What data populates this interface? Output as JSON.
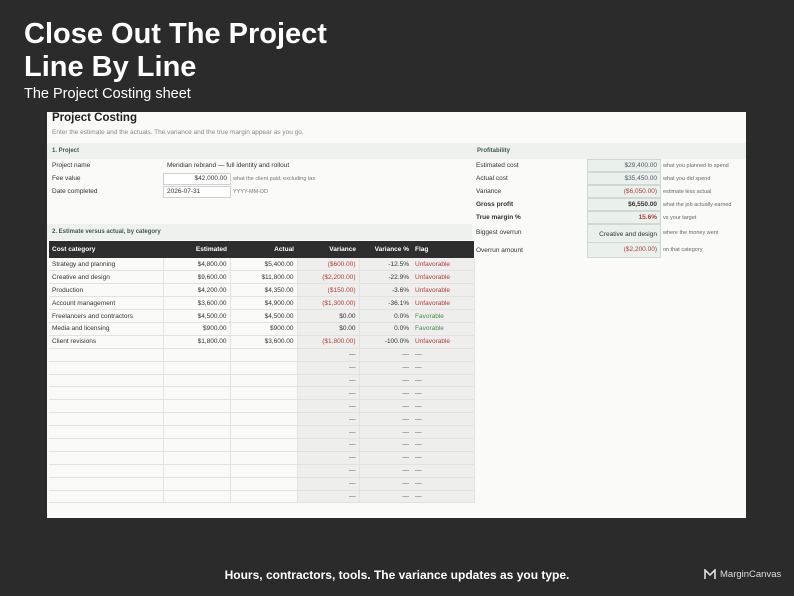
{
  "hero": {
    "title_line1": "Close Out The Project",
    "title_line2": "Line By Line",
    "subtitle": "The Project Costing sheet"
  },
  "sheet": {
    "title": "Project Costing",
    "description": "Enter the estimate and the actuals. The variance and the true margin appear as you go.",
    "project_section": "1. Project",
    "fields": {
      "project_name_label": "Project name",
      "project_name_value": "Meridian rebrand — full identity and rollout",
      "fee_value_label": "Fee value",
      "fee_value_value": "$42,000.00",
      "fee_value_note": "what the client paid, excluding tax",
      "date_completed_label": "Date completed",
      "date_completed_value": "2026-07-31",
      "date_completed_note": "YYYY-MM-DD"
    },
    "estimate_section": "2. Estimate versus actual, by category",
    "table": {
      "headers": [
        "Cost category",
        "Estimated",
        "Actual",
        "Variance",
        "Variance %",
        "Flag"
      ],
      "rows": [
        {
          "category": "Strategy and planning",
          "estimated": "$4,800.00",
          "actual": "$5,400.00",
          "variance": "($600.00)",
          "variance_pct": "-12.5%",
          "flag": "Unfavorable"
        },
        {
          "category": "Creative and design",
          "estimated": "$9,600.00",
          "actual": "$11,800.00",
          "variance": "($2,200.00)",
          "variance_pct": "-22.9%",
          "flag": "Unfavorable"
        },
        {
          "category": "Production",
          "estimated": "$4,200.00",
          "actual": "$4,350.00",
          "variance": "($150.00)",
          "variance_pct": "-3.6%",
          "flag": "Unfavorable"
        },
        {
          "category": "Account management",
          "estimated": "$3,600.00",
          "actual": "$4,900.00",
          "variance": "($1,300.00)",
          "variance_pct": "-36.1%",
          "flag": "Unfavorable"
        },
        {
          "category": "Freelancers and contractors",
          "estimated": "$4,500.00",
          "actual": "$4,500.00",
          "variance": "$0.00",
          "variance_pct": "0.0%",
          "flag": "Favorable"
        },
        {
          "category": "Media and licensing",
          "estimated": "$900.00",
          "actual": "$900.00",
          "variance": "$0.00",
          "variance_pct": "0.0%",
          "flag": "Favorable"
        },
        {
          "category": "Client revisions",
          "estimated": "$1,800.00",
          "actual": "$3,600.00",
          "variance": "($1,800.00)",
          "variance_pct": "-100.0%",
          "flag": "Unfavorable"
        }
      ],
      "empty_dash": "—"
    },
    "profitability": {
      "heading": "Profitability",
      "estimated_cost_label": "Estimated cost",
      "estimated_cost_value": "$29,400.00",
      "estimated_cost_note": "what you planned to spend",
      "actual_cost_label": "Actual cost",
      "actual_cost_value": "$35,450.00",
      "actual_cost_note": "what you did spend",
      "variance_label": "Variance",
      "variance_value": "($6,050.00)",
      "variance_note": "estimate less actual",
      "gross_profit_label": "Gross profit",
      "gross_profit_value": "$6,550.00",
      "gross_profit_note": "what the job actually earned",
      "true_margin_label": "True margin %",
      "true_margin_value": "15.6%",
      "true_margin_note": "vs your target",
      "biggest_overrun_label": "Biggest overrun",
      "biggest_overrun_value": "Creative and design",
      "biggest_overrun_note": "where the money went",
      "overrun_amount_label": "Overrun amount",
      "overrun_amount_value": "($2,200.00)",
      "overrun_amount_note": "on that category"
    }
  },
  "footer": {
    "tagline": "Hours, contractors, tools. The variance updates as you type.",
    "brand": "MarginCanvas"
  },
  "colors": {
    "background": "#2b2b2b",
    "header_dark": "#2e2e2e",
    "unfavorable": "#b53a3a",
    "favorable": "#4a8a52",
    "section_band": "#eef1ee"
  }
}
